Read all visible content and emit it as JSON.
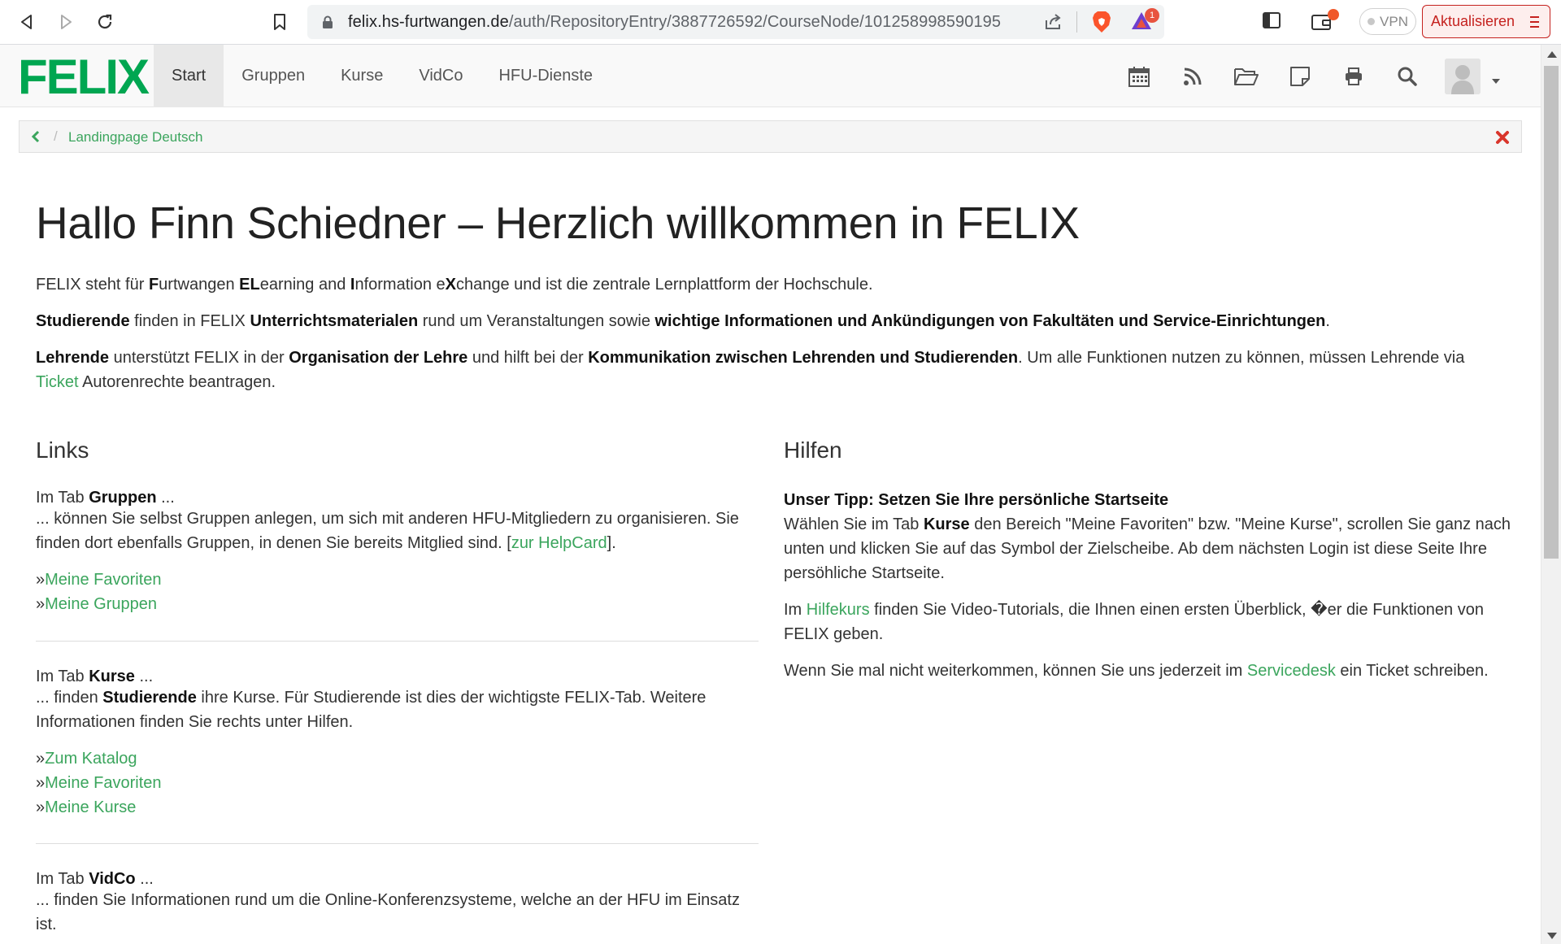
{
  "browser": {
    "url_host": "felix.hs-furtwangen.de",
    "url_path": "/auth/RepositoryEntry/3887726592/CourseNode/101258998590195",
    "rewards_badge": "1",
    "vpn_label": "VPN",
    "update_label": "Aktualisieren",
    "icons": [
      "back-icon",
      "forward-icon",
      "reload-icon",
      "bookmark-icon",
      "lock-icon",
      "share-icon",
      "brave-shields-icon",
      "brave-rewards-icon",
      "side-panel-icon",
      "wallet-icon",
      "menu-icon"
    ]
  },
  "header": {
    "logo": "FELIX",
    "tabs": [
      {
        "label": "Start"
      },
      {
        "label": "Gruppen"
      },
      {
        "label": "Kurse"
      },
      {
        "label": "VidCo"
      },
      {
        "label": "HFU-Dienste"
      }
    ],
    "active_tab": "Start",
    "tool_icons": [
      "calendar-icon",
      "rss-icon",
      "folder-icon",
      "notes-icon",
      "print-icon",
      "search-icon",
      "help-icon"
    ]
  },
  "breadcrumb": {
    "current": "Landingpage Deutsch"
  },
  "page": {
    "title": "Hallo Finn Schiedner – Herzlich willkommen in FELIX",
    "intro": {
      "p1_pre": "FELIX steht für ",
      "p1_F": "F",
      "p1_a": "urtwangen ",
      "p1_EL": "EL",
      "p1_b": "earning and ",
      "p1_I": "I",
      "p1_c": "nformation e",
      "p1_X": "X",
      "p1_post": "change und ist die zentrale Lernplattform der Hochschule.",
      "p2_b1": "Studierende",
      "p2_t1": " finden in FELIX ",
      "p2_b2": "Unterrichtsmaterialen",
      "p2_t2": " rund um Veranstaltungen sowie ",
      "p2_b3": "wichtige Informationen und Ankündigungen von Fakultäten und Service-Einrichtungen",
      "p2_t3": ".",
      "p3_b1": "Lehrende",
      "p3_t1": " unterstützt FELIX in der ",
      "p3_b2": "Organisation der Lehre",
      "p3_t2": " und hilft bei der ",
      "p3_b3": "Kommunikation zwischen Lehrenden und Studierenden",
      "p3_t3": ". Um alle Funktionen nutzen zu können, müssen Lehrende via",
      "p3_link": "Ticket",
      "p3_t4": " Autorenrechte beantragen."
    },
    "links": {
      "title": "Links",
      "gruppen": {
        "lead_pre": "Im Tab ",
        "lead_bold": "Gruppen",
        "lead_post": " ...",
        "text": "... können Sie selbst Gruppen anlegen, um sich mit anderen HFU-Mitgliedern zu organisieren. Sie finden dort ebenfalls Gruppen, in denen Sie bereits Mitglied sind. [",
        "helpcard": "zur HelpCard",
        "text_end": "].",
        "items": [
          "Meine Favoriten",
          "Meine Gruppen"
        ]
      },
      "kurse": {
        "lead_pre": "Im Tab ",
        "lead_bold": "Kurse",
        "lead_post": " ...",
        "t1": "... finden ",
        "b1": "Studierende",
        "t2": " ihre Kurse. Für Studierende ist dies der wichtigste FELIX-Tab. Weitere Informationen finden Sie rechts unter Hilfen.",
        "items": [
          "Zum Katalog",
          "Meine Favoriten",
          "Meine Kurse"
        ]
      },
      "vidco": {
        "lead_pre": "Im Tab ",
        "lead_bold": "VidCo",
        "lead_post": " ...",
        "text": "... finden Sie Informationen rund um die Online-Konferenzsysteme, welche an der HFU im Einsatz ist."
      },
      "bullet": "»"
    },
    "help": {
      "title": "Hilfen",
      "tip_title": "Unser Tipp: Setzen Sie Ihre persönliche Startseite",
      "tip_t1": "Wählen Sie im Tab ",
      "tip_b1": "Kurse",
      "tip_t2": " den Bereich \"Meine Favoriten\" bzw. \"Meine Kurse\", scrollen Sie ganz nach unten und klicken Sie auf das Symbol der Zielscheibe. Ab dem nächsten Login ist diese Seite Ihre persöhliche Startseite.",
      "p2_t1": "Im ",
      "p2_link": "Hilfekurs",
      "p2_t2": " finden Sie Video-Tutorials, die Ihnen einen ersten Überblick, �er die Funktionen von FELIX geben.",
      "p3_t1": "Wenn Sie mal nicht weiterkommen, können Sie uns jederzeit im ",
      "p3_link": "Servicedesk",
      "p3_t2": " ein Ticket schreiben."
    }
  },
  "colors": {
    "brand_green": "#00a651",
    "link_green": "#3ba55d",
    "close_red": "#d9352b"
  }
}
